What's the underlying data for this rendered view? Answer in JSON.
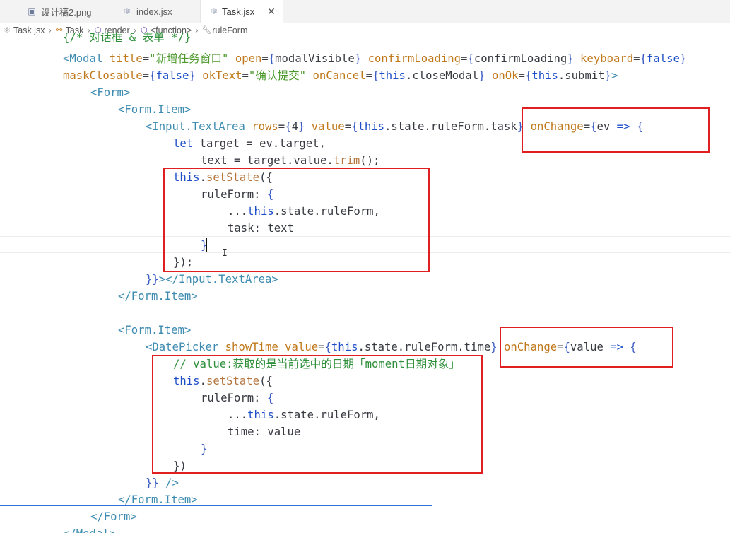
{
  "tabs": [
    {
      "label": "设计稿2.png",
      "icon": "image-icon",
      "active": false
    },
    {
      "label": "index.jsx",
      "icon": "react-icon",
      "active": false
    },
    {
      "label": "Task.jsx",
      "icon": "react-icon",
      "active": true,
      "close": "✕"
    }
  ],
  "breadcrumb": [
    {
      "label": "Task.jsx",
      "icon": "react-icon"
    },
    {
      "label": "Task",
      "icon": "class-icon"
    },
    {
      "label": "render",
      "icon": "method-icon"
    },
    {
      "label": "<function>",
      "icon": "method-icon"
    },
    {
      "label": "ruleForm",
      "icon": "wrench-icon"
    }
  ],
  "code": {
    "l0": "{/* 对话框 & 表单 */}",
    "l1": [
      [
        "<",
        "t-tag"
      ],
      [
        "Modal",
        "t-tag"
      ],
      [
        " ",
        "t-plain"
      ],
      [
        "title",
        "t-attr"
      ],
      [
        "=",
        "t-punc"
      ],
      [
        "\"新增任务窗口\"",
        "t-str"
      ],
      [
        " ",
        "t-plain"
      ],
      [
        "open",
        "t-attr"
      ],
      [
        "=",
        "t-punc"
      ],
      [
        "{",
        "t-brace"
      ],
      [
        "modalVisible",
        "t-plain"
      ],
      [
        "}",
        "t-brace"
      ],
      [
        " ",
        "t-plain"
      ],
      [
        "confirmLoading",
        "t-attr"
      ],
      [
        "=",
        "t-punc"
      ],
      [
        "{",
        "t-brace"
      ],
      [
        "confirmLoading",
        "t-plain"
      ],
      [
        "}",
        "t-brace"
      ],
      [
        " ",
        "t-plain"
      ],
      [
        "keyboard",
        "t-attr"
      ],
      [
        "=",
        "t-punc"
      ],
      [
        "{",
        "t-brace"
      ],
      [
        "false",
        "t-key"
      ],
      [
        "}",
        "t-brace"
      ]
    ],
    "l2": [
      [
        "maskClosable",
        "t-attr"
      ],
      [
        "=",
        "t-punc"
      ],
      [
        "{",
        "t-brace"
      ],
      [
        "false",
        "t-key"
      ],
      [
        "}",
        "t-brace"
      ],
      [
        " ",
        "t-plain"
      ],
      [
        "okText",
        "t-attr"
      ],
      [
        "=",
        "t-punc"
      ],
      [
        "\"确认提交\"",
        "t-str"
      ],
      [
        " ",
        "t-plain"
      ],
      [
        "onCancel",
        "t-attr"
      ],
      [
        "=",
        "t-punc"
      ],
      [
        "{",
        "t-brace"
      ],
      [
        "this",
        "t-key"
      ],
      [
        ".closeModal",
        "t-plain"
      ],
      [
        "}",
        "t-brace"
      ],
      [
        " ",
        "t-plain"
      ],
      [
        "onOk",
        "t-attr"
      ],
      [
        "=",
        "t-punc"
      ],
      [
        "{",
        "t-brace"
      ],
      [
        "this",
        "t-key"
      ],
      [
        ".submit",
        "t-plain"
      ],
      [
        "}",
        "t-brace"
      ],
      [
        ">",
        "t-tag"
      ]
    ],
    "l3": [
      [
        "<",
        "t-tag"
      ],
      [
        "Form",
        "t-tag"
      ],
      [
        ">",
        "t-tag"
      ]
    ],
    "l4": [
      [
        "<",
        "t-tag"
      ],
      [
        "Form.Item",
        "t-tag"
      ],
      [
        ">",
        "t-tag"
      ]
    ],
    "l5": [
      [
        "<",
        "t-tag"
      ],
      [
        "Input.TextArea",
        "t-tag"
      ],
      [
        " ",
        "t-plain"
      ],
      [
        "rows",
        "t-attr"
      ],
      [
        "=",
        "t-punc"
      ],
      [
        "{",
        "t-brace"
      ],
      [
        "4",
        "t-plain"
      ],
      [
        "}",
        "t-brace"
      ],
      [
        " ",
        "t-plain"
      ],
      [
        "value",
        "t-attr"
      ],
      [
        "=",
        "t-punc"
      ],
      [
        "{",
        "t-brace"
      ],
      [
        "this",
        "t-key"
      ],
      [
        ".state.ruleForm.task",
        "t-plain"
      ],
      [
        "}",
        "t-brace"
      ],
      [
        " ",
        "t-plain"
      ],
      [
        "onChange",
        "t-attr"
      ],
      [
        "=",
        "t-punc"
      ],
      [
        "{",
        "t-brace"
      ],
      [
        "ev",
        "t-plain"
      ],
      [
        " ",
        "t-plain"
      ],
      [
        "=>",
        "t-key"
      ],
      [
        " ",
        "t-plain"
      ],
      [
        "{",
        "t-brace"
      ]
    ],
    "l6": [
      [
        "let",
        "t-key"
      ],
      [
        " target = ev.target,",
        "t-plain"
      ]
    ],
    "l7": [
      [
        "text = target.value.",
        "t-plain"
      ],
      [
        "trim",
        "t-fn"
      ],
      [
        "();",
        "t-plain"
      ]
    ],
    "l8": [
      [
        "this",
        "t-key"
      ],
      [
        ".",
        "t-plain"
      ],
      [
        "setState",
        "t-fn"
      ],
      [
        "({",
        "t-plain"
      ]
    ],
    "l9": [
      [
        "ruleForm: ",
        "t-plain"
      ],
      [
        "{",
        "t-brace"
      ]
    ],
    "l10": [
      [
        "...",
        "t-plain"
      ],
      [
        "this",
        "t-key"
      ],
      [
        ".state.ruleForm,",
        "t-plain"
      ]
    ],
    "l11": [
      [
        "task: text",
        "t-plain"
      ]
    ],
    "l12": [
      [
        "}",
        "t-brace"
      ]
    ],
    "l13": [
      [
        "});",
        "t-plain"
      ]
    ],
    "l14": [
      [
        "}}",
        "t-brace"
      ],
      [
        "></",
        "t-tag"
      ],
      [
        "Input.TextArea",
        "t-tag"
      ],
      [
        ">",
        "t-tag"
      ]
    ],
    "l15": [
      [
        "</",
        "t-tag"
      ],
      [
        "Form.Item",
        "t-tag"
      ],
      [
        ">",
        "t-tag"
      ]
    ],
    "l17": [
      [
        "<",
        "t-tag"
      ],
      [
        "Form.Item",
        "t-tag"
      ],
      [
        ">",
        "t-tag"
      ]
    ],
    "l18": [
      [
        "<",
        "t-tag"
      ],
      [
        "DatePicker",
        "t-tag"
      ],
      [
        " ",
        "t-plain"
      ],
      [
        "showTime",
        "t-attr"
      ],
      [
        " ",
        "t-plain"
      ],
      [
        "value",
        "t-attr"
      ],
      [
        "=",
        "t-punc"
      ],
      [
        "{",
        "t-brace"
      ],
      [
        "this",
        "t-key"
      ],
      [
        ".state.ruleForm.time",
        "t-plain"
      ],
      [
        "}",
        "t-brace"
      ],
      [
        " ",
        "t-plain"
      ],
      [
        "onChange",
        "t-attr"
      ],
      [
        "=",
        "t-punc"
      ],
      [
        "{",
        "t-brace"
      ],
      [
        "value",
        "t-plain"
      ],
      [
        " ",
        "t-plain"
      ],
      [
        "=>",
        "t-key"
      ],
      [
        " ",
        "t-plain"
      ],
      [
        "{",
        "t-brace"
      ]
    ],
    "l19": [
      [
        "// value:获取的是当前选中的日期「moment日期对象」",
        "t-com"
      ]
    ],
    "l20": [
      [
        "this",
        "t-key"
      ],
      [
        ".",
        "t-plain"
      ],
      [
        "setState",
        "t-fn"
      ],
      [
        "({",
        "t-plain"
      ]
    ],
    "l21": [
      [
        "ruleForm: ",
        "t-plain"
      ],
      [
        "{",
        "t-brace"
      ]
    ],
    "l22": [
      [
        "...",
        "t-plain"
      ],
      [
        "this",
        "t-key"
      ],
      [
        ".state.ruleForm,",
        "t-plain"
      ]
    ],
    "l23": [
      [
        "time: value",
        "t-plain"
      ]
    ],
    "l24": [
      [
        "}",
        "t-brace"
      ]
    ],
    "l25": [
      [
        "})",
        "t-plain"
      ]
    ],
    "l26": [
      [
        "}}",
        "t-brace"
      ],
      [
        " />",
        "t-tag"
      ]
    ],
    "l27": [
      [
        "</",
        "t-tag"
      ],
      [
        "Form.Item",
        "t-tag"
      ],
      [
        ">",
        "t-tag"
      ]
    ],
    "l28": [
      [
        "</",
        "t-tag"
      ],
      [
        "Form",
        "t-tag"
      ],
      [
        ">",
        "t-tag"
      ]
    ],
    "l29": [
      [
        "</",
        "t-tag"
      ],
      [
        "Modal",
        "t-tag"
      ],
      [
        ">",
        "t-tag"
      ]
    ]
  },
  "cursor_glyph": "I",
  "colors": {
    "highlight_box": "#e02020",
    "tag": "#3d8bb0",
    "attribute": "#c0781a",
    "string": "#4e9a2e",
    "keyword": "#1f4fc8"
  }
}
